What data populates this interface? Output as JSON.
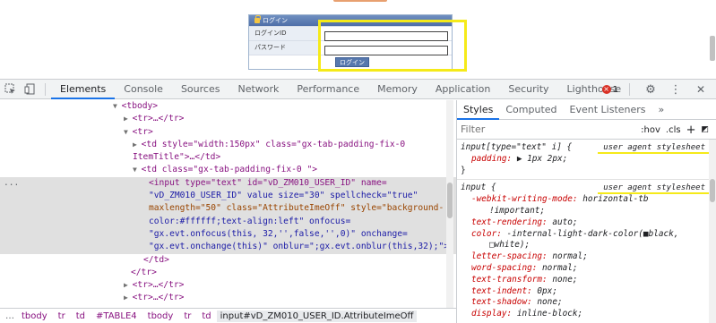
{
  "page": {
    "login_title": "ログイン",
    "login_id_label": "ログインID",
    "password_label": "パスワード",
    "login_button": "ログイン"
  },
  "devtools": {
    "tabs": [
      {
        "label": "Elements"
      },
      {
        "label": "Console"
      },
      {
        "label": "Sources"
      },
      {
        "label": "Network"
      },
      {
        "label": "Performance"
      },
      {
        "label": "Memory"
      },
      {
        "label": "Application"
      },
      {
        "label": "Security"
      },
      {
        "label": "Lighthouse"
      }
    ],
    "error_count": "1",
    "dom": {
      "l1": "<tbody>",
      "l2": "<tr>…</tr>",
      "l3": "<tr>",
      "l4a": "<td style=\"width:150px\" class=\"gx-tab-padding-fix-0",
      "l4b": "ItemTitle\">…</td>",
      "l5": "<td class=\"gx-tab-padding-fix-0   \">",
      "s1": "<input type=\"text\" id=\"vD_ZM010_USER_ID\" name=",
      "s2": "\"vD_ZM010_USER_ID\" value size=\"30\" spellcheck=\"true\"",
      "s3": "maxlength=\"50\" class=\"AttributeImeOff\" style=\"background-",
      "s4": "color:#ffffff;text-align:left\" onfocus=",
      "s5": "\"gx.evt.onfocus(this, 32,'',false,'',0)\" onchange=",
      "s6": "\"gx.evt.onchange(this)\" onblur=\";gx.evt.onblur(this,32);\">",
      "l6": "</td>",
      "l7": "</tr>",
      "l8": "<tr>…</tr>",
      "l9": "<tr>…</tr>",
      "dots": "..."
    },
    "breadcrumb": [
      "tbody",
      "tr",
      "td",
      "#TABLE4",
      "tbody",
      "tr",
      "td",
      "input#vD_ZM010_USER_ID.AttributeImeOff"
    ],
    "styles_tabs": [
      "Styles",
      "Computed",
      "Event Listeners",
      "»"
    ],
    "filter_placeholder": "Filter",
    "filter_hov": ":hov",
    "filter_cls": ".cls",
    "rules": {
      "r1_selector": "input[type=\"text\" i] {",
      "r1_origin": "user agent stylesheet",
      "r1_p1_name": "padding",
      "r1_p1_val": "▶ 1px 2px;",
      "close": "}",
      "r2_selector": "input {",
      "r2_origin": "user agent stylesheet",
      "props": [
        {
          "name": "-webkit-writing-mode",
          "val": "horizontal-tb"
        },
        {
          "name": "",
          "val": "!important;"
        },
        {
          "name": "text-rendering",
          "val": "auto;"
        },
        {
          "name": "color",
          "val": "-internal-light-dark-color(■black,"
        },
        {
          "name": "",
          "val": "□white);"
        },
        {
          "name": "letter-spacing",
          "val": "normal;"
        },
        {
          "name": "word-spacing",
          "val": "normal;"
        },
        {
          "name": "text-transform",
          "val": "none;"
        },
        {
          "name": "text-indent",
          "val": "0px;"
        },
        {
          "name": "text-shadow",
          "val": "none;"
        },
        {
          "name": "display",
          "val": "inline-block;"
        }
      ]
    }
  }
}
